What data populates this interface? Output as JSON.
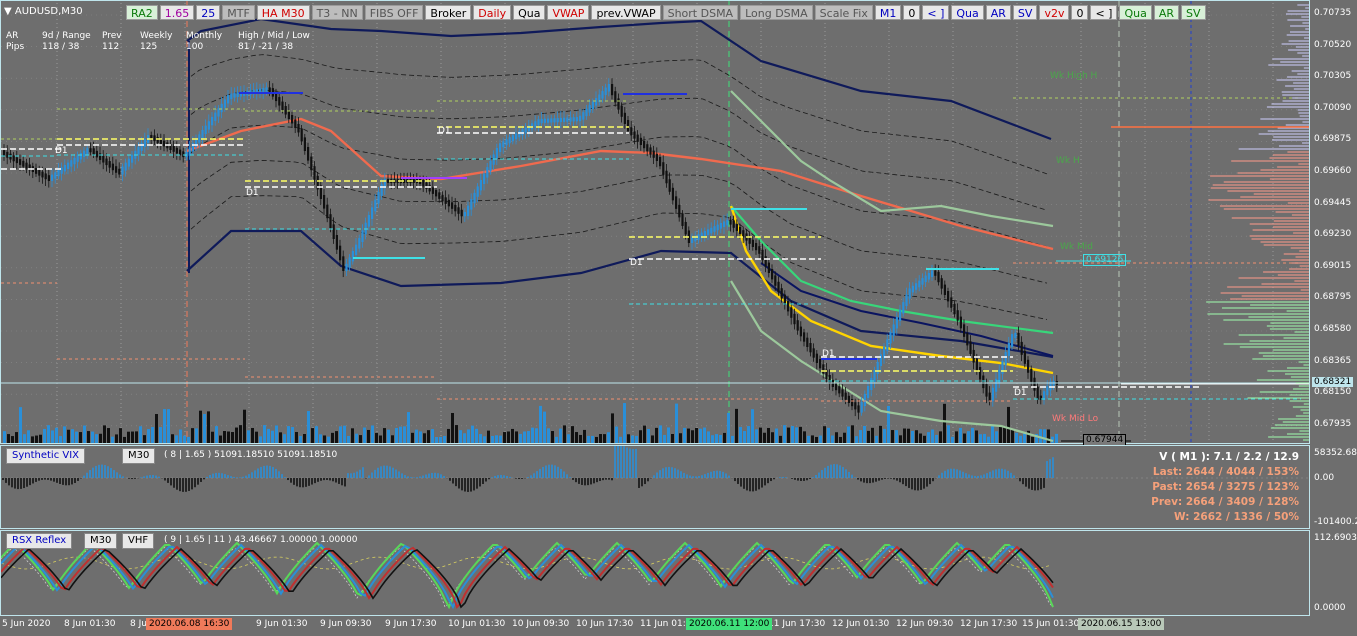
{
  "symbol": "AUDUSD,M30",
  "toolbar": [
    {
      "label": "RA2",
      "color": "#0a7a0a",
      "bg": "#d8f0d8"
    },
    {
      "label": "1.65",
      "color": "#a000a0",
      "bg": "#e8e8e8"
    },
    {
      "label": "25",
      "color": "#0000c0",
      "bg": "#e8e8e8"
    },
    {
      "label": "MTF",
      "color": "#555555",
      "bg": "#bdbdbd"
    },
    {
      "label": "HA M30",
      "color": "#d00000",
      "bg": "#e8e8e8"
    },
    {
      "label": "T3 - NN",
      "color": "#555555",
      "bg": "#bdbdbd"
    },
    {
      "label": "FIBS OFF",
      "color": "#555555",
      "bg": "#bdbdbd"
    },
    {
      "label": "Broker",
      "color": "#000000",
      "bg": "#e8e8e8"
    },
    {
      "label": "Daily",
      "color": "#d00000",
      "bg": "#e8e8e8"
    },
    {
      "label": "Qua",
      "color": "#000000",
      "bg": "#e8e8e8"
    },
    {
      "label": "VWAP",
      "color": "#d00000",
      "bg": "#e8e8e8"
    },
    {
      "label": "prev.VWAP",
      "color": "#000000",
      "bg": "#e8e8e8"
    },
    {
      "label": "Short DSMA",
      "color": "#555555",
      "bg": "#bdbdbd"
    },
    {
      "label": "Long DSMA",
      "color": "#555555",
      "bg": "#bdbdbd"
    },
    {
      "label": "Scale Fix",
      "color": "#555555",
      "bg": "#bdbdbd"
    },
    {
      "label": "M1",
      "color": "#0000c0",
      "bg": "#e8e8e8"
    },
    {
      "label": "0",
      "color": "#000000",
      "bg": "#e8e8e8"
    },
    {
      "label": "< ]",
      "color": "#0000c0",
      "bg": "#e8e8e8"
    },
    {
      "label": "Qua",
      "color": "#0000c0",
      "bg": "#e8e8e8"
    },
    {
      "label": "AR",
      "color": "#0000c0",
      "bg": "#e8e8e8"
    },
    {
      "label": "SV",
      "color": "#0000c0",
      "bg": "#e8e8e8"
    },
    {
      "label": "v2v",
      "color": "#d00000",
      "bg": "#e8e8e8"
    },
    {
      "label": "0",
      "color": "#000000",
      "bg": "#e8e8e8"
    },
    {
      "label": "< ]",
      "color": "#000000",
      "bg": "#e8e8e8"
    },
    {
      "label": "Qua",
      "color": "#0a7a0a",
      "bg": "#d8f0d8"
    },
    {
      "label": "AR",
      "color": "#0a7a0a",
      "bg": "#d8f0d8"
    },
    {
      "label": "SV",
      "color": "#0a7a0a",
      "bg": "#d8f0d8"
    }
  ],
  "stats": {
    "row1": [
      "AR",
      "9d / Range",
      "Prev",
      "Weekly",
      "Monthly",
      "High / Mid / Low"
    ],
    "row2": [
      "Pips",
      "118 / 38",
      "112",
      "125",
      "100",
      "81 / -21 / 38"
    ]
  },
  "price_axis": [
    "0.70735",
    "0.70520",
    "0.70305",
    "0.70090",
    "0.69875",
    "0.69660",
    "0.69445",
    "0.69230",
    "0.69015",
    "0.68795",
    "0.68580",
    "0.68365",
    "0.68150",
    "0.67935"
  ],
  "price_tags": {
    "current": "0.68321",
    "mid": "0.69126",
    "low": "0.67944"
  },
  "chart_labels": {
    "d1": "D1",
    "wk_high": "Wk High H",
    "wk_h": "Wk H",
    "wk_mid": "Wk Mid",
    "wk_mid_lo": "Wk Mid Lo"
  },
  "synthetic_vix": {
    "name": "Synthetic VIX",
    "tf": "M30",
    "params": "( 8 | 1.65 ) 51091.18510 51091.18510",
    "axis": [
      "58352.68",
      "0.00",
      "-101400.25"
    ]
  },
  "rsx": {
    "name": "RSX Reflex",
    "tf": "M30",
    "extra": "VHF",
    "params": "( 9 | 1.65 | 11 ) 43.46667 1.00000 1.00000",
    "axis": [
      "112.69036",
      "0.0000"
    ]
  },
  "volume_stats": {
    "title": "V ( M1 ): 7.1 / 2.2 / 12.9",
    "rows": [
      "Last: 2644 / 4044 / 153%",
      "Past: 2654 / 3275 / 123%",
      "Prev: 2664 / 3409 / 128%",
      "W: 2662 / 1336 / 50%"
    ]
  },
  "time_axis": [
    "5 Jun 2020",
    "8 Jun 01:30",
    "8 Ju",
    "9 Jun 01:30",
    "9 Jun 09:30",
    "9 Jun 17:30",
    "10 Jun 01:30",
    "10 Jun 09:30",
    "10 Jun 17:30",
    "11 Jun 01:",
    "11 Jun 17:30",
    "12 Jun 01:30",
    "12 Jun 09:30",
    "12 Jun 17:30",
    "15 Jun 01:30"
  ],
  "time_highlights": [
    {
      "label": "2020.06.08 16:30",
      "bg": "#f07a5a"
    },
    {
      "label": "2020.06.11 12:00",
      "bg": "#3fe07a"
    },
    {
      "label": "2020.06.15 13:00",
      "bg": "#b8c8b8"
    }
  ],
  "colors": {
    "bull": "#2a8fd8",
    "bear": "#111111",
    "vwap": "#f06a4e",
    "envelope": "#0f1a5a",
    "yellow": "#ffd400",
    "green": "#38d67a",
    "sage": "#9cc89c",
    "cyan": "#3fe0e6"
  }
}
